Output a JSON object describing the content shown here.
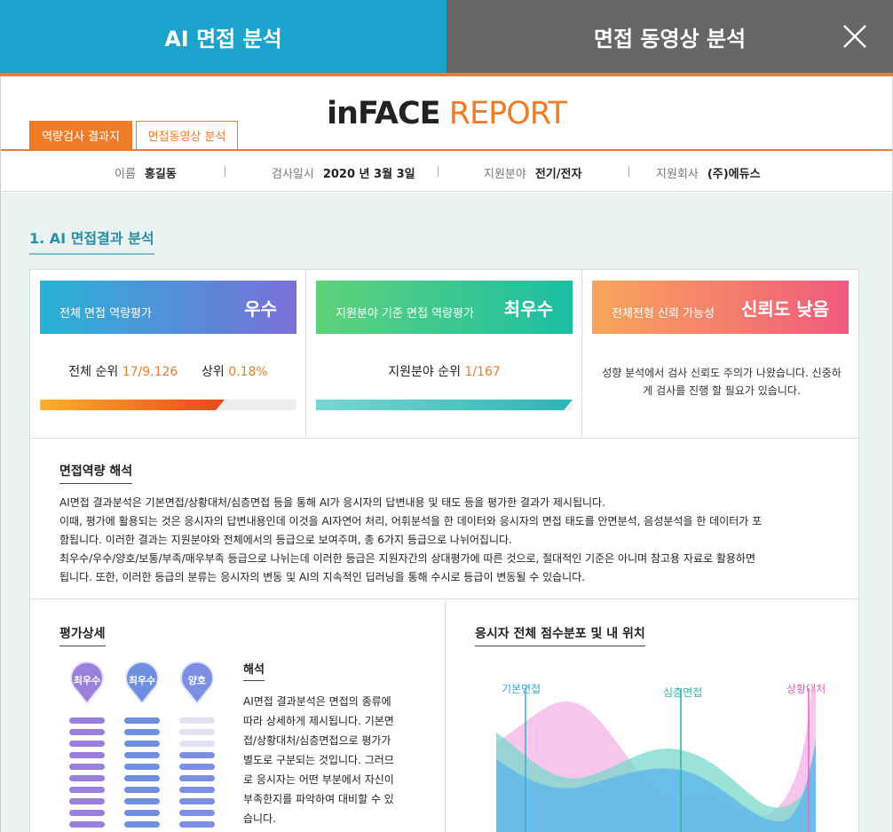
{
  "top_tabs": {
    "ai_analysis": "AI 면접 분석",
    "video_analysis": "면접 동영상 분석"
  },
  "report": {
    "brand": "inFACE",
    "title_suffix": " REPORT"
  },
  "sub_tabs": {
    "result": "역량검사 결과지",
    "video": "면접동영상 분석"
  },
  "info": {
    "name_label": "이름",
    "name_value": "홍길동",
    "date_label": "검사일시",
    "date_value": "2020 년 3월 3일",
    "field_label": "지원분야",
    "field_value": "전기/전자",
    "company_label": "지원회사",
    "company_value": "(주)에듀스"
  },
  "section1_title": "1. AI 면접결과 분석",
  "cards": [
    {
      "title": "전체 면접 역량평가",
      "grade": "우수",
      "rank_label": "전체 순위",
      "rank_value": "17/9,126",
      "top_label": "상위",
      "top_value": "0.18%",
      "bar_fill": 0.72
    },
    {
      "title": "지원분야 기준 면접 역량평가",
      "grade": "최우수",
      "rank_label": "지원분야 순위",
      "rank_value": "1/167",
      "bar_fill": 1.0
    },
    {
      "title": "전체전형 신뢰 가능성",
      "grade": "신뢰도 낮음",
      "note": "성향 분석에서 검사 신뢰도 주의가 나왔습니다. 신중하게 검사를 진행 할 필요가 있습니다."
    }
  ],
  "interpretation": {
    "title": "면접역량 해석",
    "lines": [
      "AI면접 결과분석은 기본면접/상황대처/심층면접 등을 통해 AI가 응시자의 답변내용 및 태도 등을 평가한 결과가 제시됩니다.",
      "이때, 평가에 활용되는 것은 응시자의 답변내용인데 이것을 AI자연어 처리, 어휘분석을 한 데이터와 응시자의 면접 태도를 안면분석, 음성분석을 한 데이터가 포",
      "함됩니다. 이러한 결과는 지원분야와 전체에서의 등급으로 보여주며, 총 6가지 등급으로 나뉘어집니다.",
      "최우수/우수/양호/보통/부족/매우부족 등급으로 나뉘는데 이러한 등급은 지원자간의 상대평가에 따른 것으로, 절대적인 기준은 아니며 참고용 자료로 활용하면",
      "됩니다. 또한, 이러한 등급의 분류는 응시자의 변동 및 AI의 지속적인 딥러닝을 통해 수시로 등급이 변동될 수 있습니다."
    ]
  },
  "detail": {
    "title": "평가상세",
    "pins": [
      {
        "label": "최우수",
        "color": "#9a7fdc",
        "level": 1.0
      },
      {
        "label": "최우수",
        "color": "#6f8fe0",
        "level": 1.0
      },
      {
        "label": "양호",
        "color": "#7c8fe4",
        "level": 0.7
      }
    ],
    "interp_title": "해석",
    "interp_lines": [
      "AI면접 결과분석은 면접의 종류에",
      "따라 상세하게 제시됩니다. 기본면",
      "접/상황대처/심층면접으로 평가가",
      "별도로 구분되는 것입니다. 그러므",
      "로 응시자는 어떤 부분에서 자신이",
      "부족한지를 파악하여 대비할 수 있",
      "습니다."
    ]
  },
  "distribution": {
    "title": "응시자 전체 점수분포 및 내 위치",
    "labels": [
      {
        "text": "기본면접",
        "color": "#3aa9d6"
      },
      {
        "text": "심층면접",
        "color": "#2fb3a0"
      },
      {
        "text": "상황대처",
        "color": "#e066b8"
      }
    ],
    "colors": {
      "basic": "#62b9ea",
      "deep": "#7ad8cc",
      "situation": "#f6b3e6"
    }
  }
}
